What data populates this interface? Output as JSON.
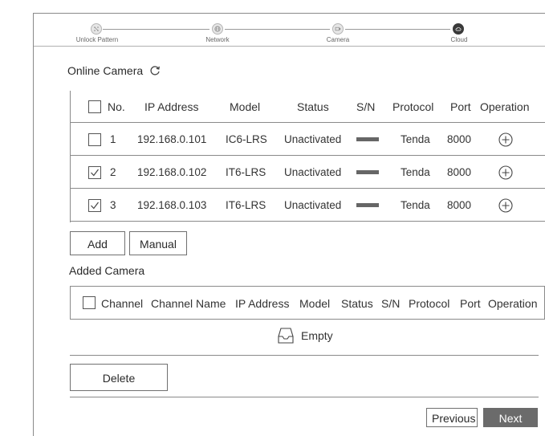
{
  "wizard": {
    "steps": [
      {
        "label": "Unlock Pattern",
        "icon": "pattern-icon"
      },
      {
        "label": "Network",
        "icon": "globe-icon"
      },
      {
        "label": "Camera",
        "icon": "camera-icon"
      },
      {
        "label": "Cloud",
        "icon": "cloud-icon"
      }
    ],
    "active_step": "Cloud"
  },
  "online": {
    "title": "Online Camera",
    "refresh_icon": "refresh-icon",
    "headers": {
      "no": "No.",
      "ip": "IP Address",
      "model": "Model",
      "status": "Status",
      "sn": "S/N",
      "protocol": "Protocol",
      "port": "Port",
      "operation": "Operation"
    },
    "rows": [
      {
        "no": "1",
        "ip": "192.168.0.101",
        "model": "IC6-LRS",
        "status": "Unactivated",
        "protocol": "Tenda",
        "port": "8000",
        "checked": false
      },
      {
        "no": "2",
        "ip": "192.168.0.102",
        "model": "IT6-LRS",
        "status": "Unactivated",
        "protocol": "Tenda",
        "port": "8000",
        "checked": true
      },
      {
        "no": "3",
        "ip": "192.168.0.103",
        "model": "IT6-LRS",
        "status": "Unactivated",
        "protocol": "Tenda",
        "port": "8000",
        "checked": true
      }
    ]
  },
  "buttons": {
    "add": "Add",
    "manual": "Manual",
    "delete": "Delete",
    "previous": "Previous",
    "next": "Next"
  },
  "added": {
    "title": "Added Camera",
    "headers": {
      "channel": "Channel",
      "channel_name": "Channel Name",
      "ip": "IP Address",
      "model": "Model",
      "status": "Status",
      "sn": "S/N",
      "protocol": "Protocol",
      "port": "Port",
      "operation": "Operation"
    },
    "empty_text": "Empty"
  },
  "colors": {
    "border": "#8a8a8a",
    "next_button_bg": "#6b6b6b",
    "active_step": "#3a3a3a"
  }
}
